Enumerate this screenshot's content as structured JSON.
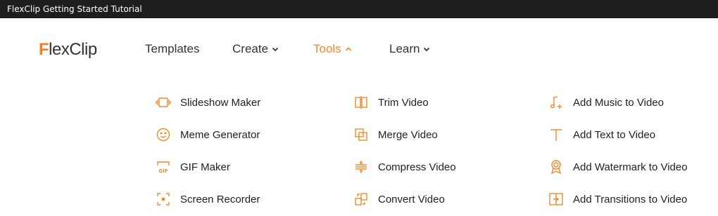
{
  "window": {
    "title": "FlexClip Getting Started Tutorial"
  },
  "brand": {
    "logo_text": "FlexClip",
    "accent": "#f08a2c"
  },
  "nav": {
    "items": [
      {
        "label": "Templates",
        "has_dropdown": false,
        "active": false
      },
      {
        "label": "Create",
        "has_dropdown": true,
        "active": false
      },
      {
        "label": "Tools",
        "has_dropdown": true,
        "active": true
      },
      {
        "label": "Learn",
        "has_dropdown": true,
        "active": false
      }
    ]
  },
  "tools_menu": {
    "columns": [
      [
        {
          "label": "Slideshow Maker",
          "icon": "slideshow-icon"
        },
        {
          "label": "Meme Generator",
          "icon": "smiley-icon"
        },
        {
          "label": "GIF Maker",
          "icon": "gif-icon"
        },
        {
          "label": "Screen Recorder",
          "icon": "screen-record-icon"
        }
      ],
      [
        {
          "label": "Trim Video",
          "icon": "trim-icon"
        },
        {
          "label": "Merge Video",
          "icon": "merge-icon"
        },
        {
          "label": "Compress Video",
          "icon": "compress-icon"
        },
        {
          "label": "Convert Video",
          "icon": "convert-icon"
        }
      ],
      [
        {
          "label": "Add Music to Video",
          "icon": "music-note-icon"
        },
        {
          "label": "Add Text to Video",
          "icon": "text-icon"
        },
        {
          "label": "Add Watermark to Video",
          "icon": "watermark-icon"
        },
        {
          "label": "Add Transitions to Video",
          "icon": "transition-icon"
        }
      ]
    ]
  }
}
